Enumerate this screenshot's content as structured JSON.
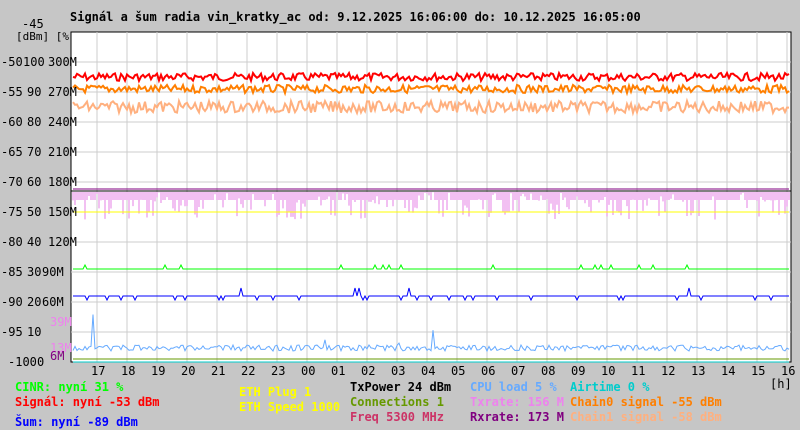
{
  "chart_data": {
    "type": "line",
    "title": "Signál a šum radia vin_kratky_ac od: 9.12.2025 16:06:00 do: 10.12.2025 16:05:00",
    "ylabel": "[dBm] [%]",
    "xlabel": "[h]",
    "ylim": [
      -100,
      -45
    ],
    "y_ticks_dbm": [
      "-45",
      "-50",
      "-55",
      "-60",
      "-65",
      "-70",
      "-75",
      "-80",
      "-85",
      "-90",
      "-95",
      "-100"
    ],
    "y_ticks_pct": [
      "100",
      "90",
      "80",
      "70",
      "60",
      "50",
      "40",
      "30",
      "20",
      "10",
      "0"
    ],
    "y_ticks_rate": [
      "300M",
      "270M",
      "240M",
      "210M",
      "180M",
      "150M",
      "120M",
      "90M",
      "60M"
    ],
    "x_ticks": [
      "17",
      "18",
      "19",
      "20",
      "21",
      "22",
      "23",
      "00",
      "01",
      "02",
      "03",
      "04",
      "05",
      "06",
      "07",
      "08",
      "09",
      "10",
      "11",
      "12",
      "13",
      "14",
      "15",
      "16"
    ],
    "grid": true,
    "extra_labels": [
      {
        "text": "39M",
        "color": "#ee82ee"
      },
      {
        "text": "13M",
        "color": "#ee82ee"
      },
      {
        "text": "6M",
        "color": "#800080"
      }
    ],
    "series": [
      {
        "name": "Signál",
        "color": "#ff0000",
        "value_dbm": -52.5
      },
      {
        "name": "Chain0 signal",
        "color": "#ff7f00",
        "value_dbm": -54.5
      },
      {
        "name": "Chain1 signal",
        "color": "#ffb07f",
        "value_dbm": -57.5
      },
      {
        "name": "Txrate",
        "color": "#e680e6",
        "value_rate_M": 156
      },
      {
        "name": "Rxrate",
        "color": "#800080",
        "value_rate_M": 173
      },
      {
        "name": "ETH Speed",
        "color": "#ffff00",
        "value_rate_M": 150
      },
      {
        "name": "CINR",
        "color": "#00ff00",
        "value_pct": 31
      },
      {
        "name": "Šum",
        "color": "#0000ff",
        "value_dbm": -89
      },
      {
        "name": "CPU load",
        "color": "#66aaff",
        "value_pct": 5
      },
      {
        "name": "Airtime",
        "color": "#00cccc",
        "value_pct": 0
      },
      {
        "name": "Connections",
        "color": "#669900",
        "value_pct": 1
      }
    ]
  },
  "legend": {
    "cinr": "CINR: nyní 31 %",
    "signal": "Signál: nyní -53 dBm",
    "noise": "Šum: nyní -89 dBm",
    "eth_plug": "ETH Plug 1",
    "eth_speed": "ETH Speed 1000",
    "txpower": "TxPower 24 dBm",
    "connections": "Connections 1",
    "freq": "Freq 5300 MHz",
    "cpu": "CPU load 5 %",
    "txrate": "Txrate: 156 M",
    "rxrate": "Rxrate: 173 M",
    "airtime": "Airtime 0 %",
    "chain0": "Chain0 signal -55 dBm",
    "chain1": "Chain1 signal -58 dBm"
  }
}
